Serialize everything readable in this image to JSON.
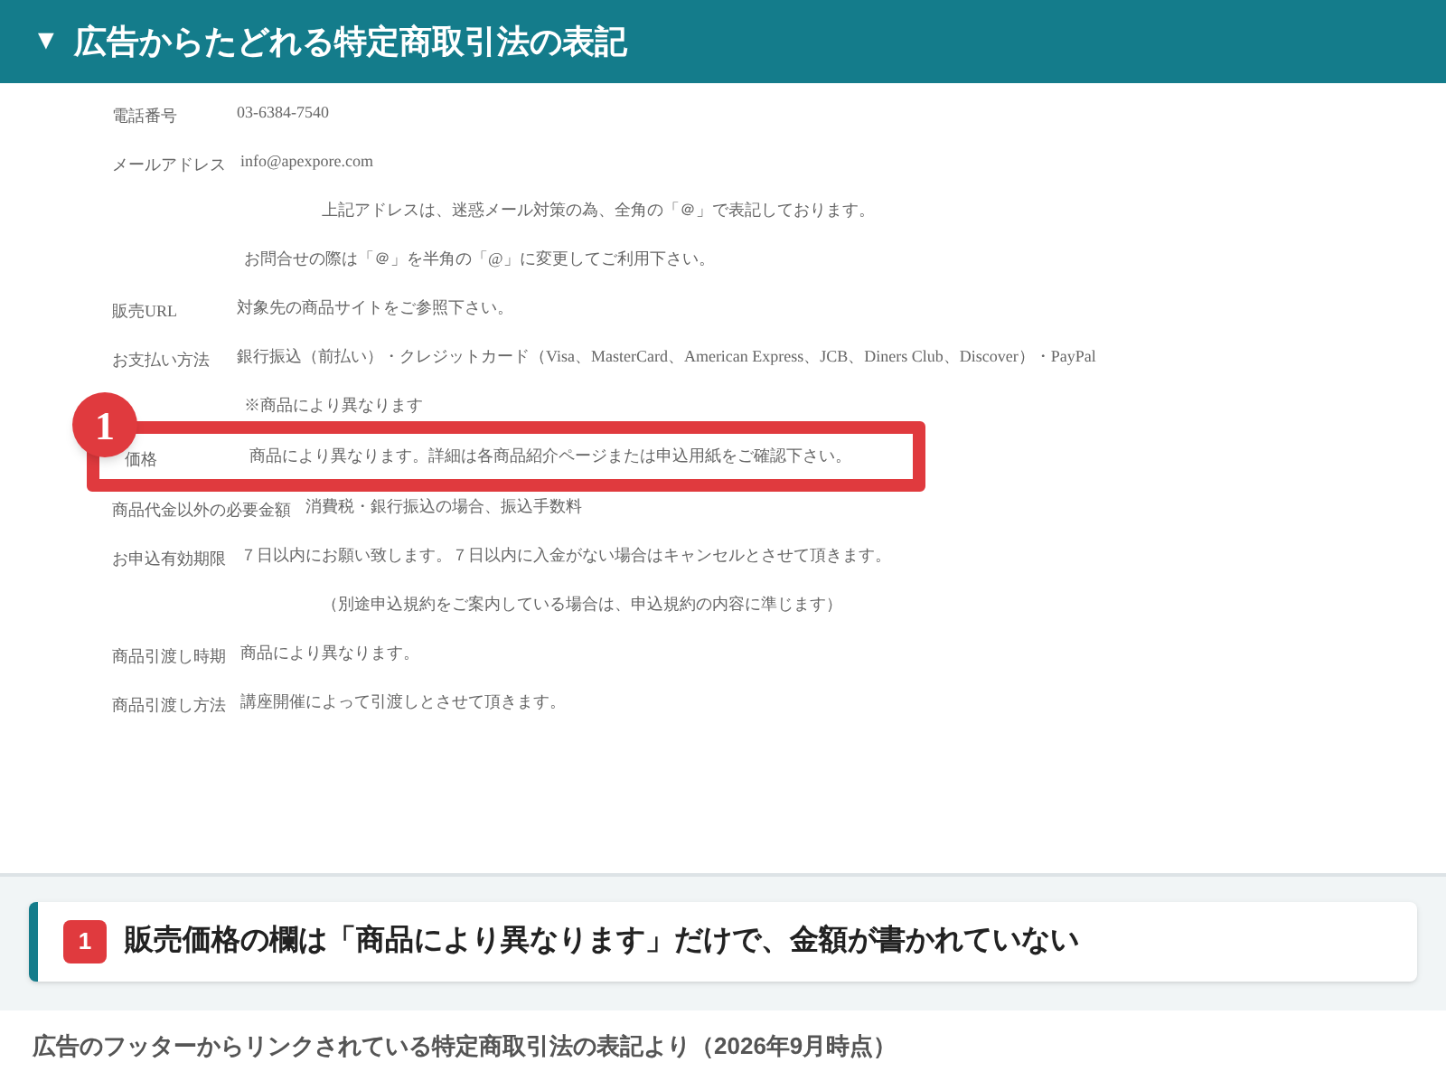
{
  "header": {
    "toggle": "▼",
    "title": "広告からたどれる特定商取引法の表記"
  },
  "document": {
    "rows": [
      {
        "kind": "row",
        "label": "電話番号",
        "value": "03-6384-7540",
        "highlighted": false
      },
      {
        "kind": "row",
        "label": "メールアドレス",
        "value": "info@apexpore.com",
        "highlighted": false
      },
      {
        "kind": "note",
        "value": "上記アドレスは、迷惑メール対策の為、全角の「＠」で表記しております。",
        "indent": true,
        "highlighted": false
      },
      {
        "kind": "note",
        "value": "お問合せの際は「＠」を半角の「@」に変更してご利用下さい。",
        "indent": false,
        "highlighted": false
      },
      {
        "kind": "row",
        "label": "販売URL",
        "value": "対象先の商品サイトをご参照下さい。",
        "highlighted": false
      },
      {
        "kind": "row",
        "label": "お支払い方法",
        "value": "銀行振込（前払い）・クレジットカード（Visa、MasterCard、American Express、JCB、Diners Club、Discover）・PayPal",
        "highlighted": false
      },
      {
        "kind": "note",
        "value": "※商品により異なります",
        "indent": false,
        "highlighted": false
      },
      {
        "kind": "row",
        "label": "価格",
        "value": "商品により異なります。詳細は各商品紹介ページまたは申込用紙をご確認下さい。",
        "highlighted": true,
        "marker": "1"
      },
      {
        "kind": "row",
        "label": "商品代金以外の必要金額",
        "value": "消費税・銀行振込の場合、振込手数料",
        "highlighted": false
      },
      {
        "kind": "row",
        "label": "お申込有効期限",
        "value": "７日以内にお願い致します。７日以内に入金がない場合はキャンセルとさせて頂きます。",
        "highlighted": false
      },
      {
        "kind": "note",
        "value": "（別途申込規約をご案内している場合は、申込規約の内容に準じます）",
        "indent": true,
        "highlighted": false
      },
      {
        "kind": "row",
        "label": "商品引渡し時期",
        "value": "商品により異なります。",
        "highlighted": false
      },
      {
        "kind": "row",
        "label": "商品引渡し方法",
        "value": "講座開催によって引渡しとさせて頂きます。",
        "highlighted": false
      }
    ]
  },
  "callout": {
    "marker": "1",
    "text": "販売価格の欄は「商品により異なります」だけで、金額が書かれていない"
  },
  "caption": "広告のフッターからリンクされている特定商取引法の表記より（2026年9月時点）"
}
